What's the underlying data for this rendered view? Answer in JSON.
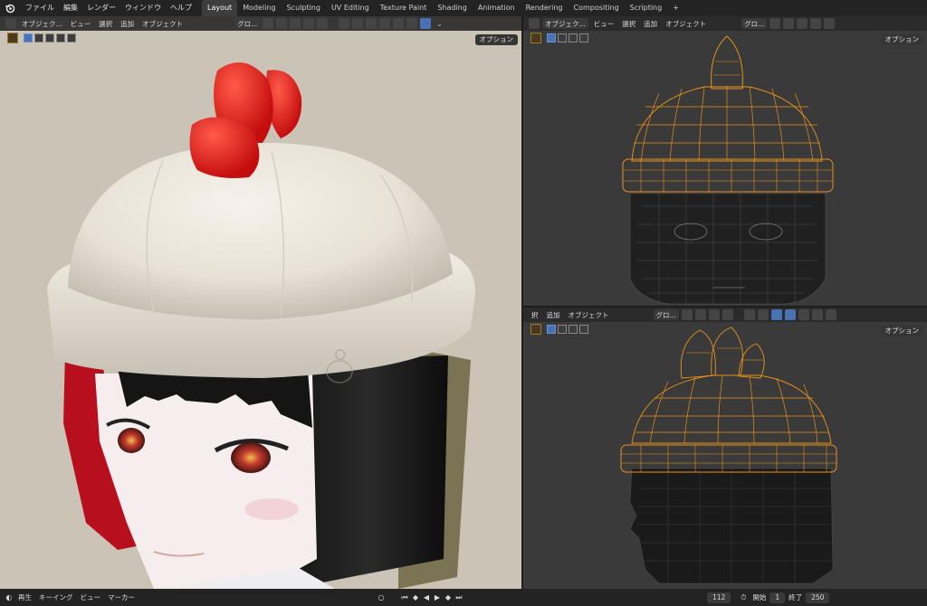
{
  "menubar": {
    "items": [
      "ファイル",
      "編集",
      "レンダー",
      "ウィンドウ",
      "ヘルプ"
    ],
    "workspaces": [
      "Layout",
      "Modeling",
      "Sculpting",
      "UV Editing",
      "Texture Paint",
      "Shading",
      "Animation",
      "Rendering",
      "Compositing",
      "Scripting"
    ],
    "active_workspace": "Layout",
    "add_symbol": "+"
  },
  "viewport_main": {
    "mode_label": "オブジェク...",
    "menus": [
      "ビュー",
      "選択",
      "追加",
      "オブジェクト"
    ],
    "transform_label": "グロ...",
    "options_label": "オプション",
    "header_tail_label": "⌄"
  },
  "viewport_front": {
    "mode_label": "オブジェク...",
    "menus": [
      "ビュー",
      "選択",
      "追加",
      "オブジェクト"
    ],
    "transform_label": "グロ...",
    "options_label": "オプション"
  },
  "viewport_side": {
    "menus": [
      "択",
      "追加",
      "オブジェクト"
    ],
    "transform_label": "グロ...",
    "options_label": "オプション"
  },
  "timeline": {
    "playback_label": "再生",
    "keying_label": "キーイング",
    "view_label": "ビュー",
    "marker_label": "マーカー",
    "current_frame": "112",
    "start_label": "開始",
    "start_value": "1",
    "end_label": "終了",
    "end_value": "250"
  },
  "colors": {
    "accent": "#4772b3",
    "wire": "#e8921a",
    "viewport_bg": "#3a3a3a"
  }
}
